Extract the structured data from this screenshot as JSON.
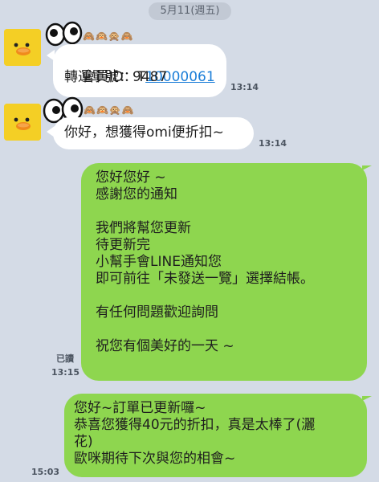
{
  "date_label": "5月11(週五)",
  "messages": [
    {
      "id": "m1",
      "line1_prefix": "會員ID：T",
      "line1_link": "10000061",
      "line2": "轉運單號：9487",
      "time": "13:14"
    },
    {
      "id": "m2",
      "text": "你好，想獲得omi便折扣~",
      "time": "13:14"
    },
    {
      "id": "m3",
      "lines": [
        "您好您好 ~",
        "感謝您的通知",
        "",
        "我們將幫您更新",
        "待更新完",
        "小幫手會LINE通知您",
        "即可前往「未發送一覽」選擇結帳。",
        "",
        "有任何問題歡迎詢問",
        "",
        "祝您有個美好的一天 ~"
      ],
      "read": "已讀",
      "time": "13:15"
    },
    {
      "id": "m4",
      "lines": [
        "您好~訂單已更新囉~",
        "恭喜您獲得40元的折扣，真是太棒了(灑",
        "花)",
        "歐咪期待下次與您的相會~"
      ],
      "time": "15:03"
    }
  ],
  "monkey_emojis": "🙈🙉🙊🙈",
  "icons": {
    "avatar": "sally-chick-avatar",
    "eyes": "googly-eyes-sticker"
  },
  "colors": {
    "background": "#d4dbe6",
    "outgoing_bubble": "#8ed64f",
    "incoming_bubble": "#ffffff",
    "link": "#1d7fd8"
  }
}
